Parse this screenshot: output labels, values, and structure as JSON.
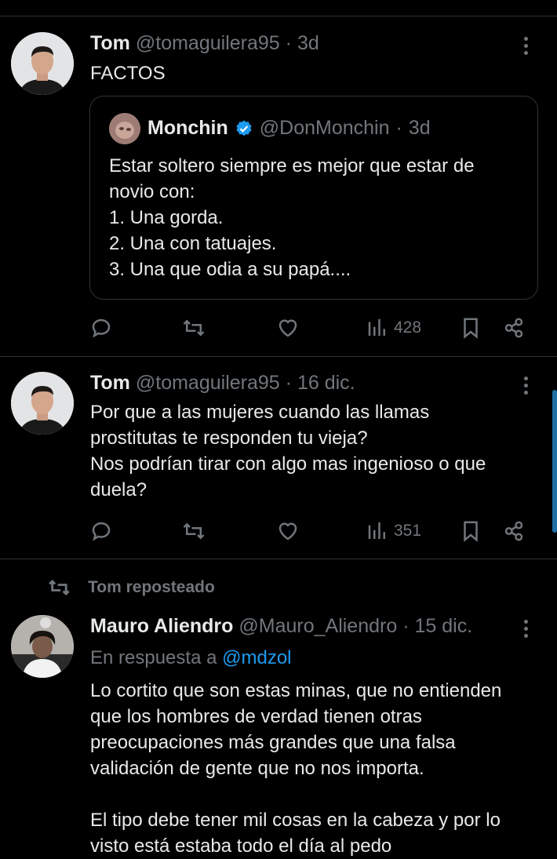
{
  "tweets": [
    {
      "name": "Tom",
      "handle": "@tomaguilera95",
      "sep": "·",
      "time": "3d",
      "text": "FACTOS",
      "quote": {
        "name": "Monchin",
        "handle": "@DonMonchin",
        "sep": "·",
        "time": "3d",
        "text": "Estar soltero siempre es mejor que estar de\nnovio con:\n1. Una gorda.\n2. Una con tatuajes.\n3. Una que odia a su papá...."
      },
      "views": "428"
    },
    {
      "name": "Tom",
      "handle": "@tomaguilera95",
      "sep": "·",
      "time": "16 dic.",
      "text": "Por que a las mujeres cuando las llamas\nprostitutas te responden tu vieja?\nNos podrían tirar con algo mas ingenioso o que\nduela?",
      "views": "351"
    },
    {
      "repost_label": "Tom reposteado",
      "name": "Mauro Aliendro",
      "handle": "@Mauro_Aliendro",
      "sep": "·",
      "time": "15 dic.",
      "reply_prefix": "En respuesta a ",
      "reply_to": "@mdzol",
      "text": "Lo cortito que son estas minas, que no entienden\nque los hombres de verdad tienen otras\npreocupaciones más grandes que una falsa\nvalidación de gente que no nos importa.\n\nEl tipo debe tener mil cosas en la cabeza y por lo\nvisto está estaba todo el día al pedo"
    }
  ],
  "colors": {
    "background": "#000000",
    "text": "#e7e9ea",
    "muted": "#71767b",
    "link": "#1d9bf0",
    "divider": "#2f3336"
  },
  "icons": [
    "reply-icon",
    "retweet-icon",
    "like-icon",
    "views-icon",
    "bookmark-icon",
    "share-icon",
    "more-icon",
    "verified-badge-icon"
  ]
}
